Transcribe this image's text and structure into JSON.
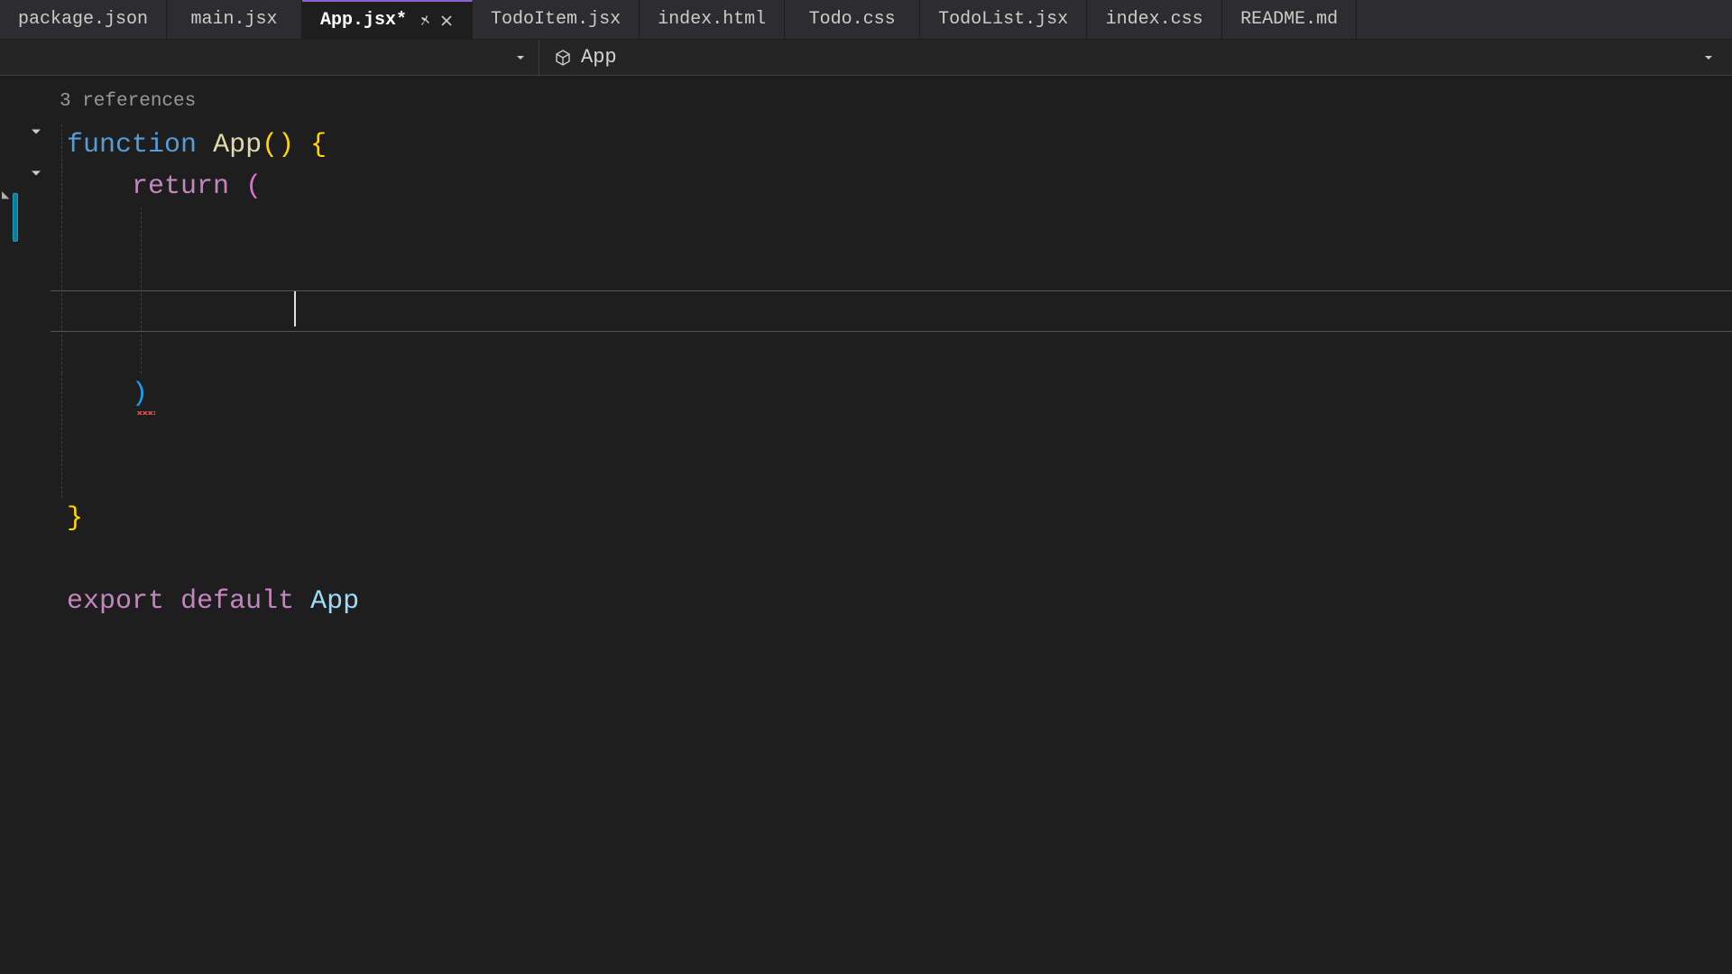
{
  "tabs": [
    {
      "label": "package.json"
    },
    {
      "label": "main.jsx"
    },
    {
      "label": "App.jsx*",
      "active": true
    },
    {
      "label": "TodoItem.jsx"
    },
    {
      "label": "index.html"
    },
    {
      "label": "Todo.css"
    },
    {
      "label": "TodoList.jsx"
    },
    {
      "label": "index.css"
    },
    {
      "label": "README.md"
    }
  ],
  "breadcrumb": {
    "symbol": "App"
  },
  "codelens": "3 references",
  "code": {
    "kw_function": "function",
    "fn_name": "App",
    "kw_return": "return",
    "kw_export": "export",
    "kw_default": "default",
    "ident_app": "App"
  }
}
